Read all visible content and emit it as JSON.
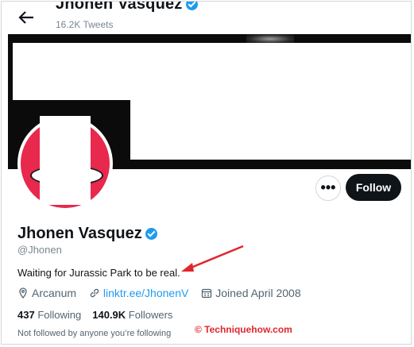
{
  "header": {
    "back_icon": "back-arrow-icon",
    "title": "Jhonen Vasquez",
    "subtitle": "16.2K Tweets"
  },
  "profile": {
    "name": "Jhonen Vasquez",
    "handle": "@Jhonen",
    "bio": "Waiting for Jurassic Park to be real.",
    "location": "Arcanum",
    "link": "linktr.ee/JhonenV",
    "joined": "Joined April 2008",
    "following_count": "437",
    "following_label": "Following",
    "followers_count": "140.9K",
    "followers_label": "Followers",
    "not_followed": "Not followed by anyone you’re following"
  },
  "actions": {
    "more_label": "•••",
    "follow_label": "Follow"
  },
  "watermark": "© Techniquehow.com",
  "colors": {
    "accent": "#1d9bf0",
    "follow_bg": "#0f1419",
    "avatar": "#e8284d",
    "annotation": "#e0262b"
  }
}
